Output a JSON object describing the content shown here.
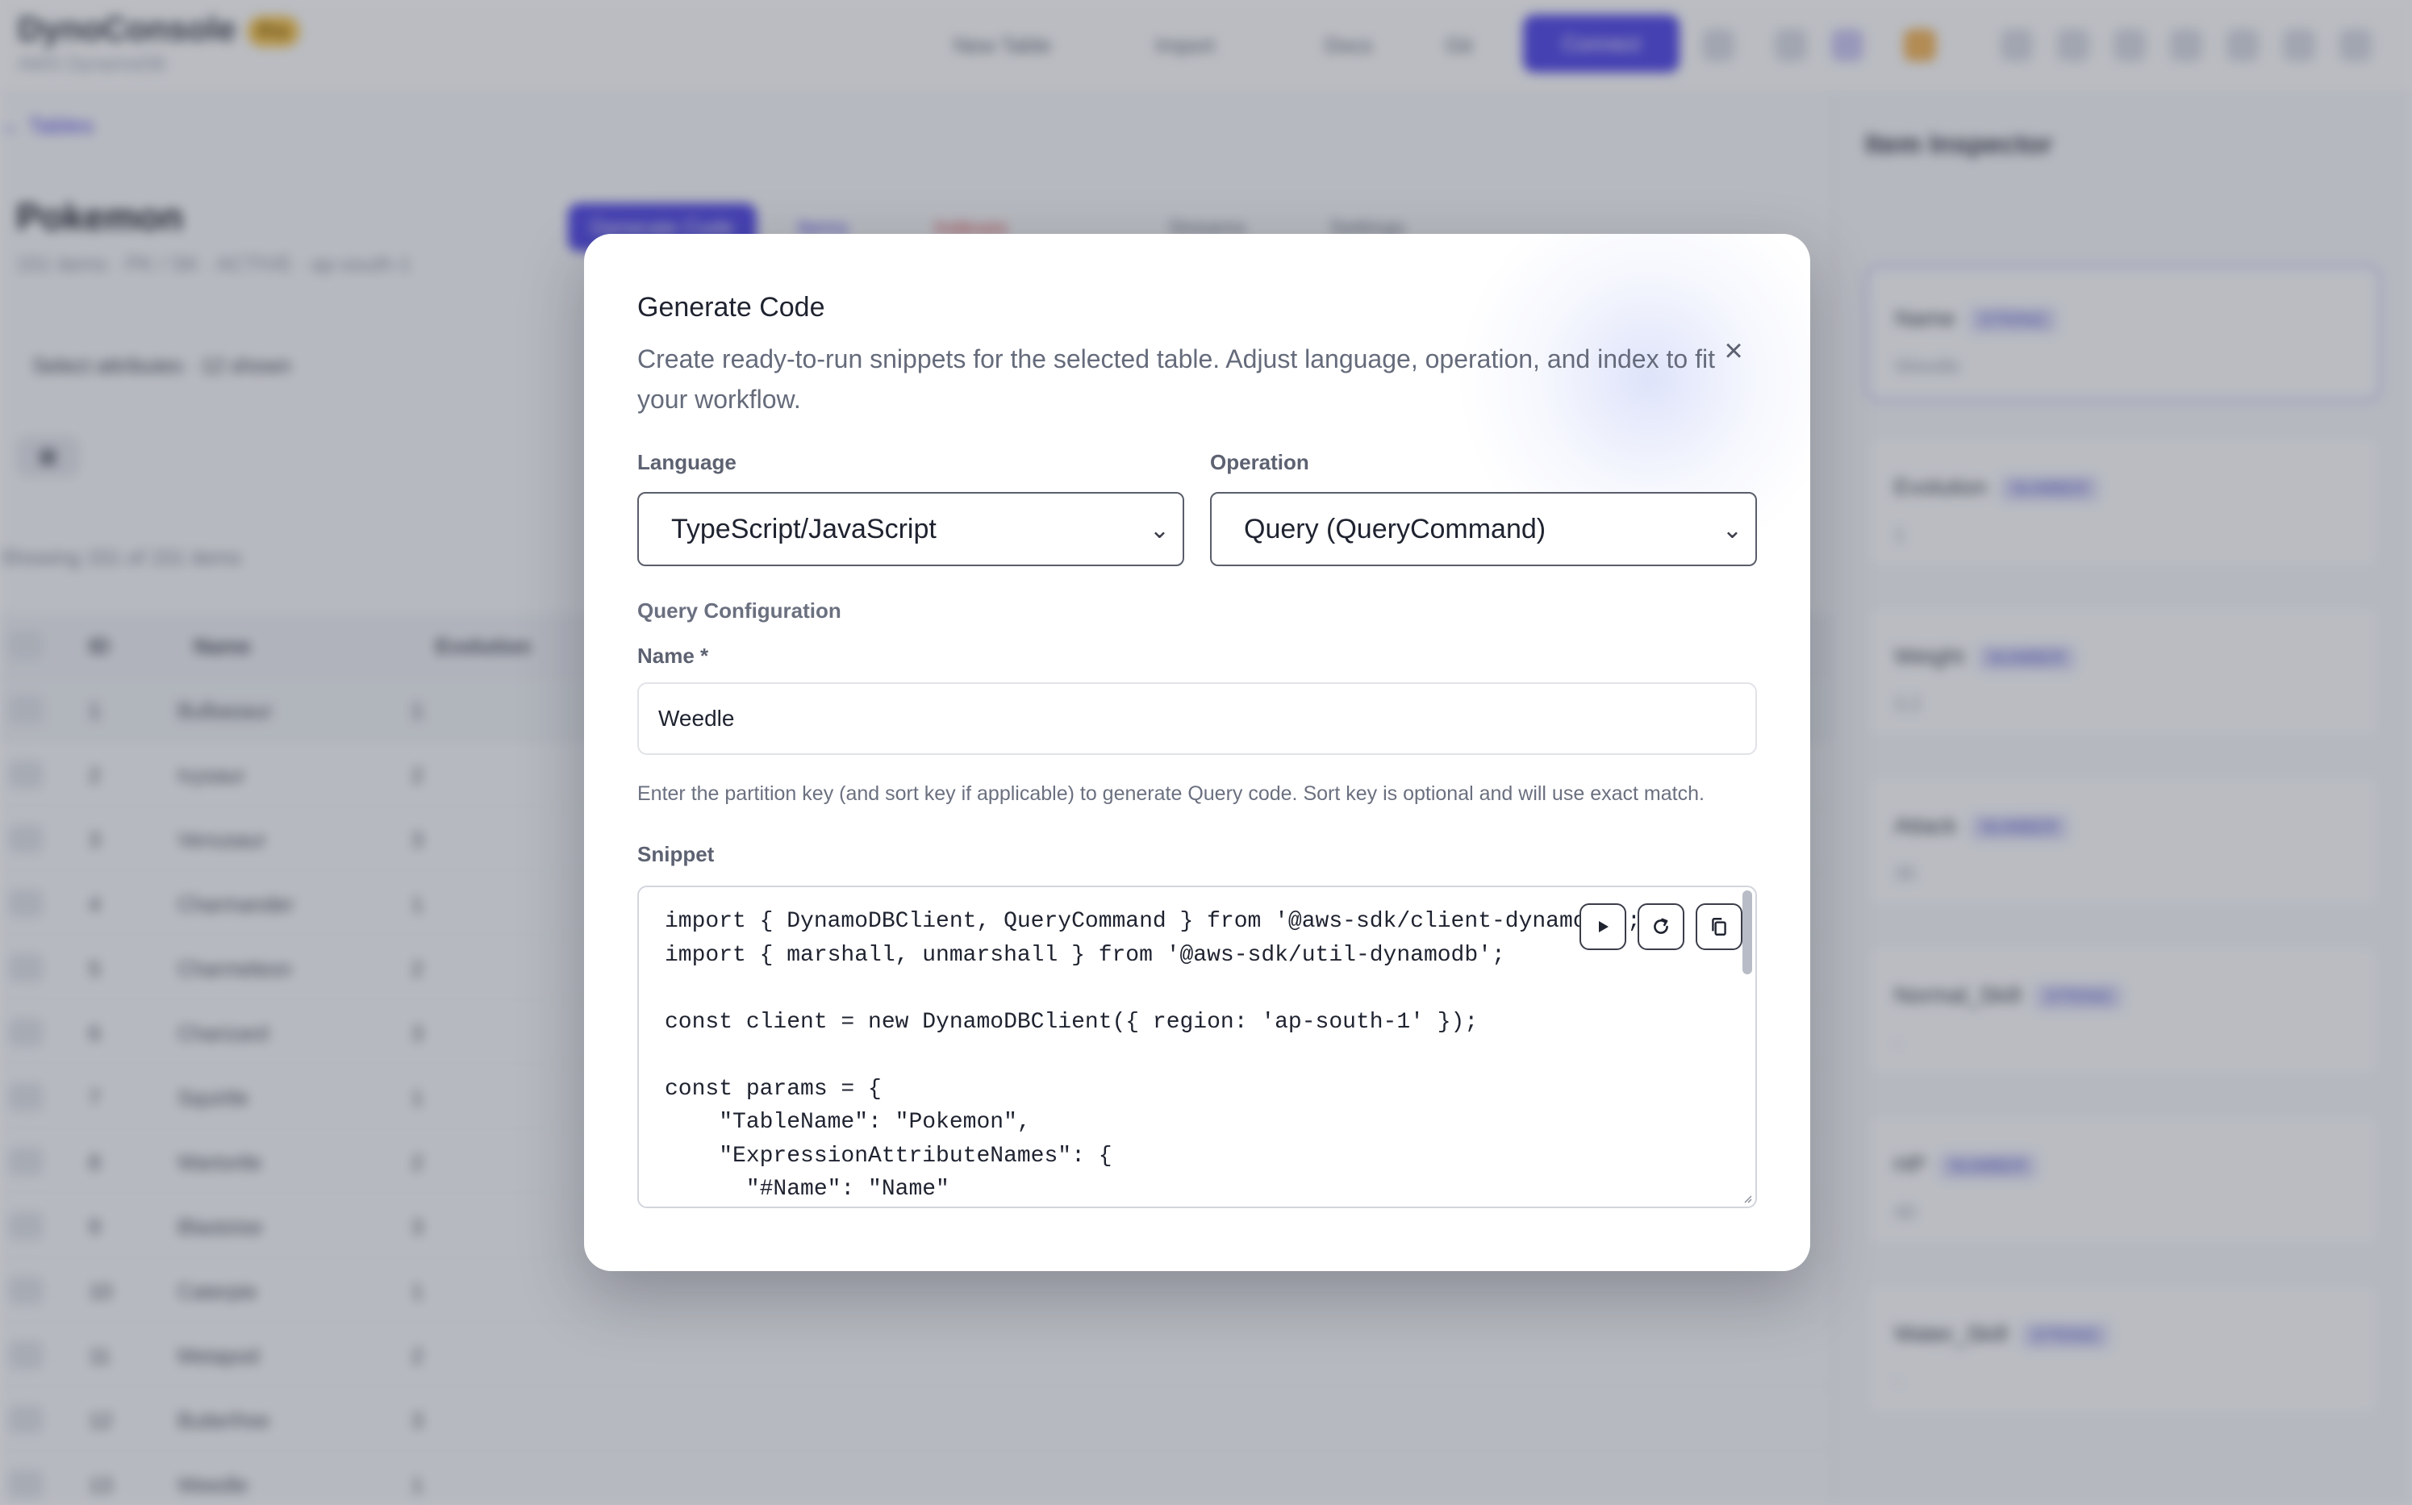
{
  "background_app": {
    "brand": "DynoConsole",
    "brand_badge": "Pro",
    "brand_sub": "AWS DynamoDB",
    "toolbar": [
      "New Table",
      "Import",
      "Docs",
      "Git",
      "Connect"
    ],
    "back_link": "← Tables",
    "page_title": "Pokemon",
    "page_meta": "151 items · PK / SK · ACTIVE · ap-south-1",
    "tabs": [
      "Generate Code",
      "Items",
      "Indexes",
      "Streams",
      "Settings"
    ],
    "filter_text": "Select attributes · 12 shown",
    "showing_text": "Showing 151 of 151 items",
    "columns": [
      "ID",
      "Name",
      "Evolution"
    ],
    "rows": [
      {
        "id": "1",
        "name": "Bulbasaur",
        "evo": "1"
      },
      {
        "id": "2",
        "name": "Ivysaur",
        "evo": "2"
      },
      {
        "id": "3",
        "name": "Venusaur",
        "evo": "3"
      },
      {
        "id": "4",
        "name": "Charmander",
        "evo": "1"
      },
      {
        "id": "5",
        "name": "Charmeleon",
        "evo": "2"
      },
      {
        "id": "6",
        "name": "Charizard",
        "evo": "3"
      },
      {
        "id": "7",
        "name": "Squirtle",
        "evo": "1"
      },
      {
        "id": "8",
        "name": "Wartortle",
        "evo": "2"
      },
      {
        "id": "9",
        "name": "Blastoise",
        "evo": "3"
      },
      {
        "id": "10",
        "name": "Caterpie",
        "evo": "1"
      },
      {
        "id": "11",
        "name": "Metapod",
        "evo": "2"
      },
      {
        "id": "12",
        "name": "Butterfree",
        "evo": "3"
      },
      {
        "id": "13",
        "name": "Weedle",
        "evo": "1"
      }
    ],
    "side_panel_title": "Item Inspector",
    "side_cards": [
      {
        "title": "Name",
        "tag": "STRING",
        "value": "Weedle"
      },
      {
        "title": "Evolution",
        "tag": "NUMBER",
        "value": "1"
      },
      {
        "title": "Weight",
        "tag": "NUMBER",
        "value": "3.2"
      },
      {
        "title": "Attack",
        "tag": "NUMBER",
        "value": "35"
      },
      {
        "title": "Normal_Skill",
        "tag": "STRING",
        "value": "-"
      },
      {
        "title": "HP",
        "tag": "NUMBER",
        "value": "40"
      },
      {
        "title": "Water_Skill",
        "tag": "STRING",
        "value": "-"
      }
    ]
  },
  "modal": {
    "title": "Generate Code",
    "description": "Create ready-to-run snippets for the selected table. Adjust language, operation, and index to fit your workflow.",
    "close_icon": "×",
    "language_label": "Language",
    "language_value": "TypeScript/JavaScript",
    "operation_label": "Operation",
    "operation_value": "Query (QueryCommand)",
    "section_label": "Query Configuration",
    "name_label": "Name *",
    "name_value": "Weedle",
    "help_text": "Enter the partition key (and sort key if applicable) to generate Query code. Sort key is optional and will use exact match.",
    "snippet_label": "Snippet",
    "snippet_code": "import { DynamoDBClient, QueryCommand } from '@aws-sdk/client-dynamodb';\nimport { marshall, unmarshall } from '@aws-sdk/util-dynamodb';\n\nconst client = new DynamoDBClient({ region: 'ap-south-1' });\n\nconst params = {\n    \"TableName\": \"Pokemon\",\n    \"ExpressionAttributeNames\": {\n      \"#Name\": \"Name\"",
    "icons": {
      "run": "play-icon",
      "refresh": "refresh-icon",
      "copy": "copy-icon"
    }
  },
  "colors": {
    "accent": "#4f46e5",
    "overlay": "rgba(50,56,72,0.32)"
  }
}
